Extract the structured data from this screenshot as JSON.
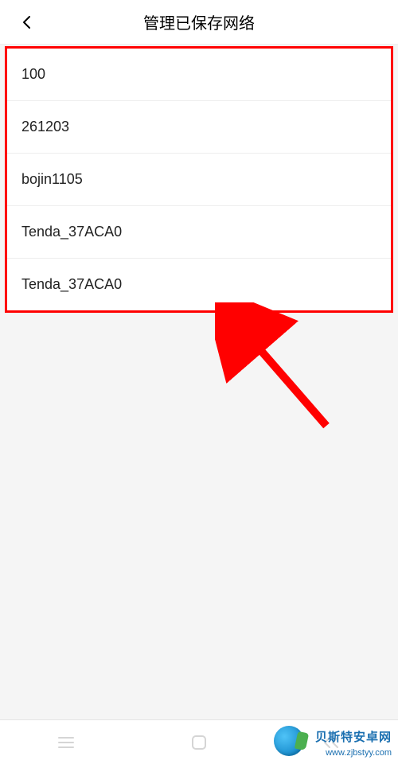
{
  "header": {
    "title": "管理已保存网络"
  },
  "networks": [
    {
      "name": "100"
    },
    {
      "name": "261203"
    },
    {
      "name": "bojin1105"
    },
    {
      "name": "Tenda_37ACA0"
    },
    {
      "name": "Tenda_37ACA0"
    }
  ],
  "watermark": {
    "text": "贝斯特安卓网",
    "url": "www.zjbstyy.com"
  },
  "annotation": {
    "highlight_color": "#ff0000"
  }
}
